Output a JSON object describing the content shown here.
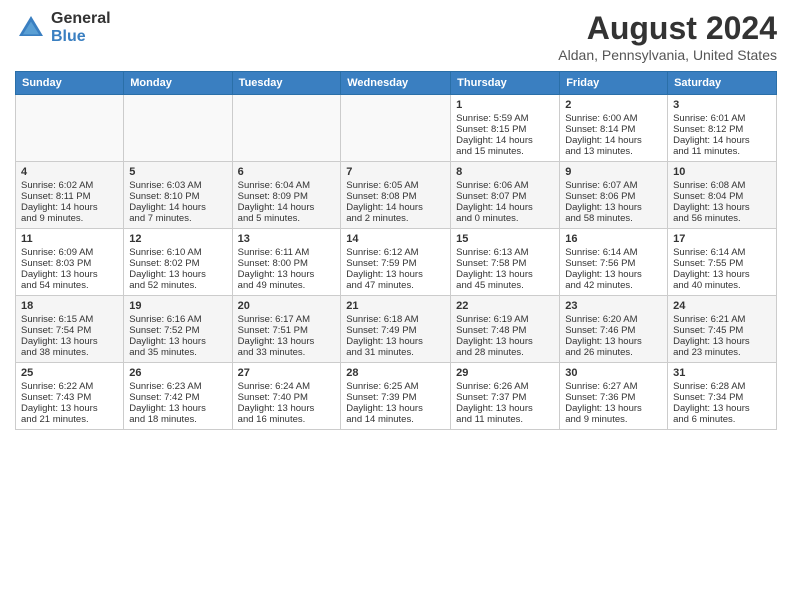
{
  "logo": {
    "general": "General",
    "blue": "Blue"
  },
  "title": "August 2024",
  "location": "Aldan, Pennsylvania, United States",
  "days_of_week": [
    "Sunday",
    "Monday",
    "Tuesday",
    "Wednesday",
    "Thursday",
    "Friday",
    "Saturday"
  ],
  "weeks": [
    [
      {
        "day": "",
        "info": ""
      },
      {
        "day": "",
        "info": ""
      },
      {
        "day": "",
        "info": ""
      },
      {
        "day": "",
        "info": ""
      },
      {
        "day": "1",
        "info": "Sunrise: 5:59 AM\nSunset: 8:15 PM\nDaylight: 14 hours\nand 15 minutes."
      },
      {
        "day": "2",
        "info": "Sunrise: 6:00 AM\nSunset: 8:14 PM\nDaylight: 14 hours\nand 13 minutes."
      },
      {
        "day": "3",
        "info": "Sunrise: 6:01 AM\nSunset: 8:12 PM\nDaylight: 14 hours\nand 11 minutes."
      }
    ],
    [
      {
        "day": "4",
        "info": "Sunrise: 6:02 AM\nSunset: 8:11 PM\nDaylight: 14 hours\nand 9 minutes."
      },
      {
        "day": "5",
        "info": "Sunrise: 6:03 AM\nSunset: 8:10 PM\nDaylight: 14 hours\nand 7 minutes."
      },
      {
        "day": "6",
        "info": "Sunrise: 6:04 AM\nSunset: 8:09 PM\nDaylight: 14 hours\nand 5 minutes."
      },
      {
        "day": "7",
        "info": "Sunrise: 6:05 AM\nSunset: 8:08 PM\nDaylight: 14 hours\nand 2 minutes."
      },
      {
        "day": "8",
        "info": "Sunrise: 6:06 AM\nSunset: 8:07 PM\nDaylight: 14 hours\nand 0 minutes."
      },
      {
        "day": "9",
        "info": "Sunrise: 6:07 AM\nSunset: 8:06 PM\nDaylight: 13 hours\nand 58 minutes."
      },
      {
        "day": "10",
        "info": "Sunrise: 6:08 AM\nSunset: 8:04 PM\nDaylight: 13 hours\nand 56 minutes."
      }
    ],
    [
      {
        "day": "11",
        "info": "Sunrise: 6:09 AM\nSunset: 8:03 PM\nDaylight: 13 hours\nand 54 minutes."
      },
      {
        "day": "12",
        "info": "Sunrise: 6:10 AM\nSunset: 8:02 PM\nDaylight: 13 hours\nand 52 minutes."
      },
      {
        "day": "13",
        "info": "Sunrise: 6:11 AM\nSunset: 8:00 PM\nDaylight: 13 hours\nand 49 minutes."
      },
      {
        "day": "14",
        "info": "Sunrise: 6:12 AM\nSunset: 7:59 PM\nDaylight: 13 hours\nand 47 minutes."
      },
      {
        "day": "15",
        "info": "Sunrise: 6:13 AM\nSunset: 7:58 PM\nDaylight: 13 hours\nand 45 minutes."
      },
      {
        "day": "16",
        "info": "Sunrise: 6:14 AM\nSunset: 7:56 PM\nDaylight: 13 hours\nand 42 minutes."
      },
      {
        "day": "17",
        "info": "Sunrise: 6:14 AM\nSunset: 7:55 PM\nDaylight: 13 hours\nand 40 minutes."
      }
    ],
    [
      {
        "day": "18",
        "info": "Sunrise: 6:15 AM\nSunset: 7:54 PM\nDaylight: 13 hours\nand 38 minutes."
      },
      {
        "day": "19",
        "info": "Sunrise: 6:16 AM\nSunset: 7:52 PM\nDaylight: 13 hours\nand 35 minutes."
      },
      {
        "day": "20",
        "info": "Sunrise: 6:17 AM\nSunset: 7:51 PM\nDaylight: 13 hours\nand 33 minutes."
      },
      {
        "day": "21",
        "info": "Sunrise: 6:18 AM\nSunset: 7:49 PM\nDaylight: 13 hours\nand 31 minutes."
      },
      {
        "day": "22",
        "info": "Sunrise: 6:19 AM\nSunset: 7:48 PM\nDaylight: 13 hours\nand 28 minutes."
      },
      {
        "day": "23",
        "info": "Sunrise: 6:20 AM\nSunset: 7:46 PM\nDaylight: 13 hours\nand 26 minutes."
      },
      {
        "day": "24",
        "info": "Sunrise: 6:21 AM\nSunset: 7:45 PM\nDaylight: 13 hours\nand 23 minutes."
      }
    ],
    [
      {
        "day": "25",
        "info": "Sunrise: 6:22 AM\nSunset: 7:43 PM\nDaylight: 13 hours\nand 21 minutes."
      },
      {
        "day": "26",
        "info": "Sunrise: 6:23 AM\nSunset: 7:42 PM\nDaylight: 13 hours\nand 18 minutes."
      },
      {
        "day": "27",
        "info": "Sunrise: 6:24 AM\nSunset: 7:40 PM\nDaylight: 13 hours\nand 16 minutes."
      },
      {
        "day": "28",
        "info": "Sunrise: 6:25 AM\nSunset: 7:39 PM\nDaylight: 13 hours\nand 14 minutes."
      },
      {
        "day": "29",
        "info": "Sunrise: 6:26 AM\nSunset: 7:37 PM\nDaylight: 13 hours\nand 11 minutes."
      },
      {
        "day": "30",
        "info": "Sunrise: 6:27 AM\nSunset: 7:36 PM\nDaylight: 13 hours\nand 9 minutes."
      },
      {
        "day": "31",
        "info": "Sunrise: 6:28 AM\nSunset: 7:34 PM\nDaylight: 13 hours\nand 6 minutes."
      }
    ]
  ]
}
